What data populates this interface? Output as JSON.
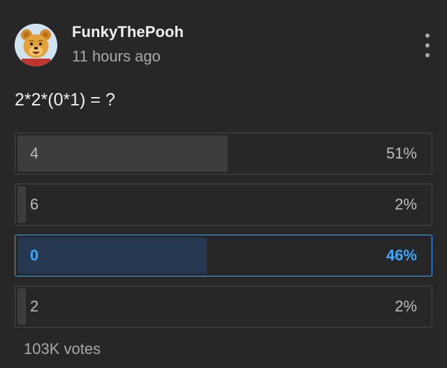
{
  "post": {
    "author": "FunkyThePooh",
    "timestamp": "11 hours ago",
    "avatar_icon": "winnie-the-pooh-avatar",
    "menu_icon": "more-vertical-icon",
    "question": "2*2*(0*1) = ?"
  },
  "poll": {
    "options": [
      {
        "label": "4",
        "percent_text": "51%",
        "fraction": 0.51,
        "selected": false
      },
      {
        "label": "6",
        "percent_text": "2%",
        "fraction": 0.02,
        "selected": false
      },
      {
        "label": "0",
        "percent_text": "46%",
        "fraction": 0.46,
        "selected": true
      },
      {
        "label": "2",
        "percent_text": "2%",
        "fraction": 0.02,
        "selected": false
      }
    ],
    "votes": "103K votes"
  },
  "colors": {
    "background": "#272727",
    "accent": "#3ea6ff",
    "selected_fill": "#263850",
    "bar_fill": "#3d3d3d",
    "border": "#484848"
  }
}
